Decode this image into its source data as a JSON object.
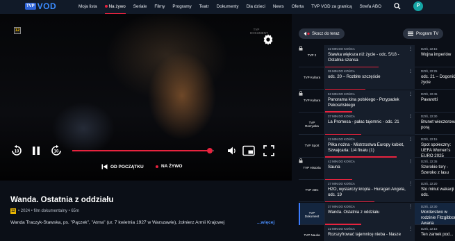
{
  "nav": {
    "logo_tvp": "TVP",
    "logo_vod": "VOD",
    "items": [
      {
        "label": "Moja lista"
      },
      {
        "label": "Na żywo",
        "active": true
      },
      {
        "label": "Seriale"
      },
      {
        "label": "Filmy"
      },
      {
        "label": "Programy"
      },
      {
        "label": "Teatr"
      },
      {
        "label": "Dokumenty"
      },
      {
        "label": "Dla dzieci"
      },
      {
        "label": "News"
      },
      {
        "label": "Oferta"
      },
      {
        "label": "TVP VOD za granicą"
      },
      {
        "label": "Strefa ABO"
      }
    ],
    "avatar_letter": "P",
    "icons": {
      "search": "search-icon"
    }
  },
  "player": {
    "age_rating": "12",
    "watermark": "TVP DOKUMENT",
    "progress_fraction": 0.97,
    "from_start_label": "OD POCZĄTKU",
    "live_label": "NA ŻYWO",
    "icons": [
      "replay-10-icon",
      "pause-icon",
      "forward-10-icon",
      "volume-icon",
      "picture-in-picture-icon",
      "fullscreen-icon",
      "settings-gear-icon"
    ]
  },
  "program": {
    "title": "Wanda. Ostatnia z oddziału",
    "age_rating": "12",
    "meta": "• 2024 • film dokumentalny • 65m",
    "description": "Wanda Traczyk-Stawska, ps. \"Pączek\", \"Atma\" (ur. 7 kwietnia 1927 w Warszawie), żołnierz Armii Krajowej",
    "more_label": "...więcej"
  },
  "epg": {
    "back_button": "Skocz do teraz",
    "program_tv_button": "Program TV",
    "rows": [
      {
        "channel": "TVP 2",
        "locked": true,
        "current": {
          "when": "22 MIN DO KOŃCA",
          "title": "Stawka większa niż życie - odc. 5/18 - Ostatnia szansa",
          "progress": 0.6
        },
        "next": {
          "when": "DZIŚ, 22:15",
          "title": "Wojna imperiów"
        }
      },
      {
        "channel": "TVP Kultura",
        "locked": false,
        "current": {
          "when": "35 MIN DO KOŃCA",
          "title": "odc. 20 – Rozbite szczęście",
          "progress": 0.45
        },
        "next": {
          "when": "DZIŚ, 22:25",
          "title": "odc. 21 – Dogonić życie"
        }
      },
      {
        "channel": "TVP Kultura",
        "locked": true,
        "current": {
          "when": "52 MIN DO KOŃCA",
          "title": "Panorama kina polskiego - Przypadek Pekosińskiego",
          "progress": 0.3
        },
        "next": {
          "when": "DZIŚ, 22:45",
          "title": "Pavarotti"
        }
      },
      {
        "channel": "TVP Rozrywka",
        "locked": false,
        "current": {
          "when": "37 MIN DO KOŃCA",
          "title": "La Promesa - pałac tajemnic - odc. 21",
          "progress": 0.4
        },
        "next": {
          "when": "DZIŚ, 22:30",
          "title": "Brunet wieczorową porą"
        }
      },
      {
        "channel": "TVP Sport",
        "locked": false,
        "current": {
          "when": "22 MIN DO KOŃCA",
          "title": "Piłka nożna - Mistrzostwa Europy kobiet, Szwajcaria: 1/4 finału (1)",
          "progress": 0.8
        },
        "next": {
          "when": "DZIŚ, 22:15",
          "title": "Spot społeczny: UEFA Women's EURO 2025"
        }
      },
      {
        "channel": "TVP Historia",
        "locked": true,
        "current": {
          "when": "42 MIN DO KOŃCA",
          "title": "Sauna",
          "progress": 0.3
        },
        "next": {
          "when": "DZIŚ, 22:35",
          "title": "Szerokie tory - Szeroko z lasu"
        }
      },
      {
        "channel": "TVP ABC",
        "locked": false,
        "current": {
          "when": "27 MIN DO KOŃCA",
          "title": "H2O, wystarczy kropla - Huragan Angela, odc. 19",
          "progress": 0.55
        },
        "next": {
          "when": "DZIŚ, 22:20",
          "title": "Sto minut wakacji - odc."
        }
      },
      {
        "channel": "TVP Dokument",
        "locked": false,
        "active": true,
        "current": {
          "when": "37 MIN DO KOŃCA",
          "title": "Wanda. Ostatnia z oddziału",
          "progress": 0.4
        },
        "next": {
          "when": "DZIŚ, 22:30",
          "title": "Morderstwo w rodzinie Fitzgibbons, Awaria"
        }
      },
      {
        "channel": "TVP Nauka",
        "locked": false,
        "current": {
          "when": "22 MIN DO KOŃCA",
          "title": "Rozszyfrować tajemnicę nieba - Nasze",
          "progress": 0.7
        },
        "next": {
          "when": "DZIŚ, 22:15",
          "title": "Ten zamek pod..."
        }
      }
    ]
  }
}
